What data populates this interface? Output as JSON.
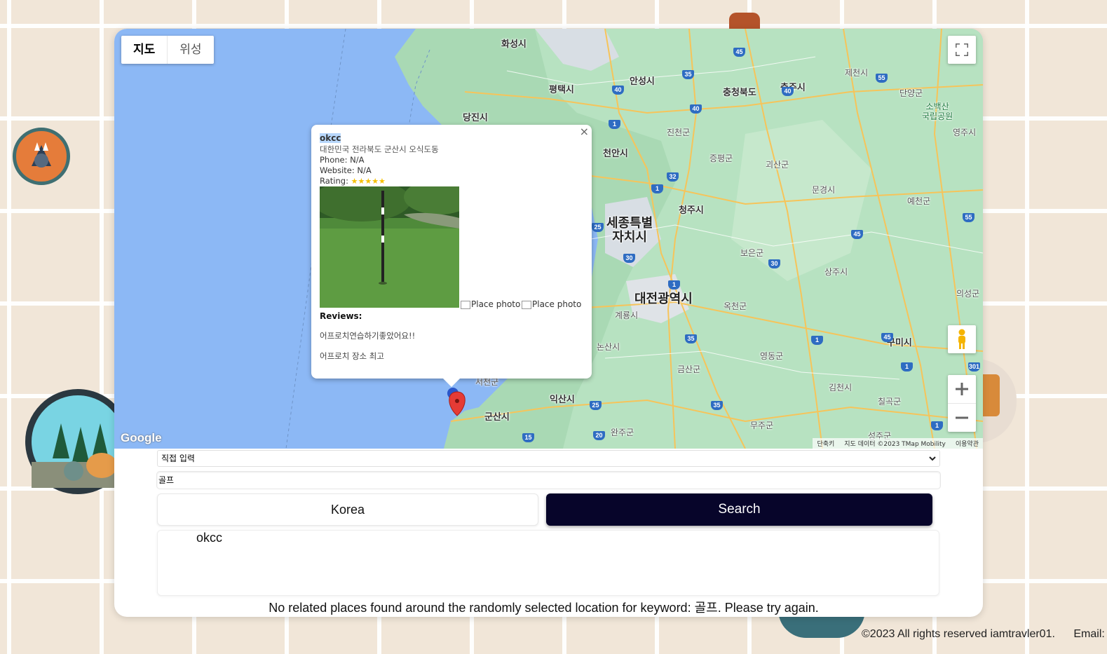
{
  "map": {
    "type_buttons": [
      "지도",
      "위성"
    ],
    "cities": [
      {
        "name": "화성시",
        "cls": "mid"
      },
      {
        "name": "평택시",
        "cls": "mid"
      },
      {
        "name": "안성시",
        "cls": "mid"
      },
      {
        "name": "충청북도",
        "cls": "mid"
      },
      {
        "name": "충주시",
        "cls": "mid"
      },
      {
        "name": "제천시",
        "cls": "small"
      },
      {
        "name": "단양군",
        "cls": "small"
      },
      {
        "name": "당진시",
        "cls": "mid"
      },
      {
        "name": "진천군",
        "cls": "small"
      },
      {
        "name": "천안시",
        "cls": "mid"
      },
      {
        "name": "증평군",
        "cls": "small"
      },
      {
        "name": "괴산군",
        "cls": "small"
      },
      {
        "name": "영주시",
        "cls": "small"
      },
      {
        "name": "문경시",
        "cls": "small"
      },
      {
        "name": "예천군",
        "cls": "small"
      },
      {
        "name": "청주시",
        "cls": "mid"
      },
      {
        "name": "보은군",
        "cls": "small"
      },
      {
        "name": "상주시",
        "cls": "small"
      },
      {
        "name": "옥천군",
        "cls": "small"
      },
      {
        "name": "계룡시",
        "cls": "small"
      },
      {
        "name": "논산시",
        "cls": "small"
      },
      {
        "name": "영동군",
        "cls": "small"
      },
      {
        "name": "구미시",
        "cls": "mid"
      },
      {
        "name": "서천군",
        "cls": "small"
      },
      {
        "name": "금산군",
        "cls": "small"
      },
      {
        "name": "김천시",
        "cls": "small"
      },
      {
        "name": "익산시",
        "cls": "mid"
      },
      {
        "name": "군산시",
        "cls": "mid"
      },
      {
        "name": "칠곡군",
        "cls": "small"
      },
      {
        "name": "완주군",
        "cls": "small"
      },
      {
        "name": "무주군",
        "cls": "small"
      },
      {
        "name": "성주군",
        "cls": "small"
      },
      {
        "name": "의성군",
        "cls": "small"
      }
    ],
    "big_cities": [
      "세종특별\n자치시",
      "대전광역시"
    ],
    "park": "소백산\n국립공원",
    "shields": [
      "45",
      "40",
      "35",
      "40",
      "55",
      "1",
      "40",
      "32",
      "1",
      "25",
      "45",
      "55",
      "30",
      "1",
      "30",
      "35",
      "45",
      "1",
      "1",
      "301",
      "25",
      "35",
      "20",
      "15",
      "1"
    ],
    "attribution": [
      "단축키",
      "지도 데이터 ©2023 TMap Mobility",
      "이용약관"
    ],
    "google_logo": "Google"
  },
  "popup": {
    "name": "okcc",
    "address": "대한민국 전라북도 군산시 오식도동",
    "phone": "Phone: N/A",
    "website": "Website: N/A",
    "rating_label": "Rating:",
    "rating": 5,
    "stars": "★★★★★",
    "photo_alt_1": "Place photo",
    "photo_alt_2": "Place photo",
    "reviews_label": "Reviews:",
    "reviews": [
      "어프로치연습하기좋았어요!!",
      "어프로치 장소 최고"
    ],
    "close_symbol": "×"
  },
  "form": {
    "select_value": "직접 입력",
    "keyword": "골프",
    "korea_button": "Korea",
    "search_button": "Search",
    "results": [
      "okcc"
    ],
    "message": "No related places found around the randomly selected location for keyword: 골프. Please try again."
  },
  "footer": {
    "copyright": "©2023 All rights reserved iamtravler01.",
    "email": "Email: ia"
  }
}
